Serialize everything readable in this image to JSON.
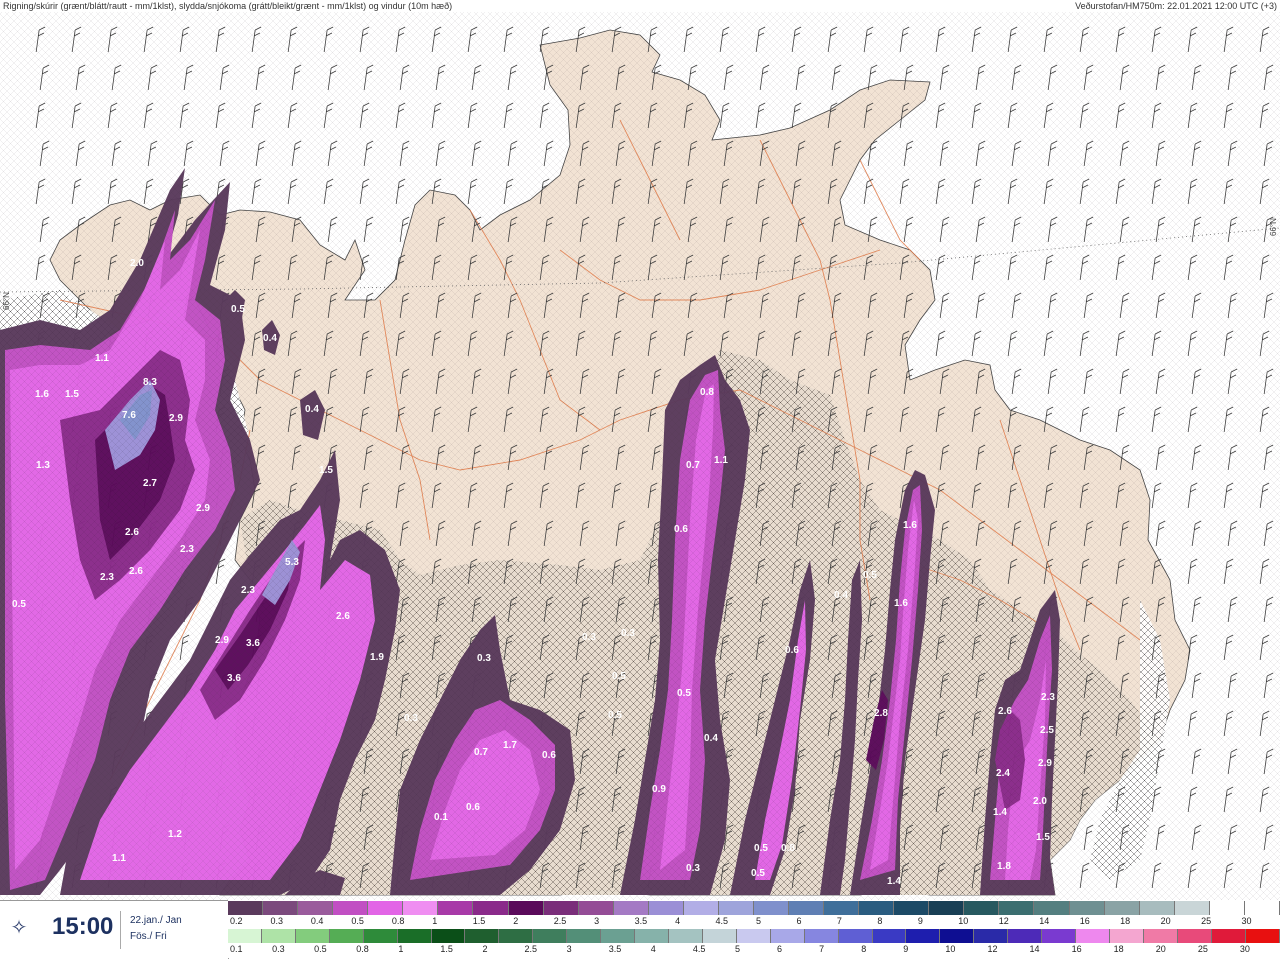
{
  "header": {
    "left": "Rigning/skúrir (grænt/blátt/rautt - mm/1klst), slydda/snjókoma (grátt/bleikt/grænt - mm/1klst) og vindur (10m hæð)",
    "right": "Veðurstofan/HM750m: 22.01.2021 12:00 UTC (+3)"
  },
  "graticule": {
    "left_label": "66°N",
    "right_label": "66°N"
  },
  "time_panel": {
    "icon": "wind-rain-icon",
    "time": "15:00",
    "date": "22.jan./ Jan",
    "day": "Fös./ Fri"
  },
  "legend": {
    "snow_row": {
      "colors": [
        "#5a3a5c",
        "#7b4a7d",
        "#9a5b9c",
        "#c14fc3",
        "#e265e6",
        "#ef8ef1",
        "#a83aa8",
        "#8a2a8a",
        "#5a0a5a",
        "#7a2e7a",
        "#944c96",
        "#a47ac4",
        "#9b8fd6",
        "#b2aee6",
        "#9ea4db",
        "#7f90cc",
        "#5f7fb4",
        "#3f6f9a",
        "#2a5c80",
        "#1c4a66",
        "#193f55",
        "#275960",
        "#3b6e70",
        "#547f80",
        "#6f9092",
        "#8aa3a5",
        "#a8bcbe",
        "#c9d5d7",
        "#ffffff",
        "#ffffff"
      ],
      "labels": [
        "0.2",
        "0.3",
        "0.4",
        "0.5",
        "0.8",
        "1",
        "1.5",
        "2",
        "2.5",
        "3",
        "3.5",
        "4",
        "4.5",
        "5",
        "6",
        "7",
        "8",
        "9",
        "10",
        "12",
        "14",
        "16",
        "18",
        "20",
        "25",
        "30"
      ]
    },
    "rain_row": {
      "colors": [
        "#d7f5d4",
        "#aee3a7",
        "#83cc7d",
        "#55ad55",
        "#2e8b3a",
        "#1a6e28",
        "#0b4f18",
        "#1f5f2f",
        "#2e6e44",
        "#3f7e5d",
        "#538f78",
        "#6ba092",
        "#86b2aa",
        "#a4c3c1",
        "#c4d4d9",
        "#c9c9ef",
        "#a8a8e8",
        "#8686e0",
        "#5f5fd4",
        "#3a3ac4",
        "#1e1eae",
        "#0e0e92",
        "#2a2aa8",
        "#4d2ab8",
        "#7a3ad0",
        "#ee88ee",
        "#f4a6d0",
        "#f07aa6",
        "#e84a7a",
        "#e01a3a",
        "#e81010"
      ],
      "labels": [
        "0.1",
        "0.3",
        "0.5",
        "0.8",
        "1",
        "1.5",
        "2",
        "2.5",
        "3",
        "3.5",
        "4",
        "4.5",
        "5",
        "6",
        "7",
        "8",
        "9",
        "10",
        "12",
        "14",
        "16",
        "18",
        "20",
        "25",
        "30"
      ]
    }
  },
  "map_values": [
    {
      "v": "2.0"
    },
    {
      "v": "0.5"
    },
    {
      "v": "0.4"
    },
    {
      "v": "1.1"
    },
    {
      "v": "8.3"
    },
    {
      "v": "1.6"
    },
    {
      "v": "1.5"
    },
    {
      "v": "7.6"
    },
    {
      "v": "2.9"
    },
    {
      "v": "0.4"
    },
    {
      "v": "1.3"
    },
    {
      "v": "2.7"
    },
    {
      "v": "1.5"
    },
    {
      "v": "2.9"
    },
    {
      "v": "2.6"
    },
    {
      "v": "2.3"
    },
    {
      "v": "5.3"
    },
    {
      "v": "2.3"
    },
    {
      "v": "2.6"
    },
    {
      "v": "2.3"
    },
    {
      "v": "0.5"
    },
    {
      "v": "2.6"
    },
    {
      "v": "2.9"
    },
    {
      "v": "3.6"
    },
    {
      "v": "1.9"
    },
    {
      "v": "3.6"
    },
    {
      "v": "0.3"
    },
    {
      "v": "0.8"
    },
    {
      "v": "0.7"
    },
    {
      "v": "1.1"
    },
    {
      "v": "0.6"
    },
    {
      "v": "1.6"
    },
    {
      "v": "0.4"
    },
    {
      "v": "0.5"
    },
    {
      "v": "1.6"
    },
    {
      "v": "0.3"
    },
    {
      "v": "0.3"
    },
    {
      "v": "0.6"
    },
    {
      "v": "0.5"
    },
    {
      "v": "0.5"
    },
    {
      "v": "0.5"
    },
    {
      "v": "0.3"
    },
    {
      "v": "0.7"
    },
    {
      "v": "1.7"
    },
    {
      "v": "0.6"
    },
    {
      "v": "0.4"
    },
    {
      "v": "2.8"
    },
    {
      "v": "2.6"
    },
    {
      "v": "2.3"
    },
    {
      "v": "2.5"
    },
    {
      "v": "2.4"
    },
    {
      "v": "2.9"
    },
    {
      "v": "1.4"
    },
    {
      "v": "2.0"
    },
    {
      "v": "0.9"
    },
    {
      "v": "1.5"
    },
    {
      "v": "0.1"
    },
    {
      "v": "0.6"
    },
    {
      "v": "0.5"
    },
    {
      "v": "0.8"
    },
    {
      "v": "0.3"
    },
    {
      "v": "0.5"
    },
    {
      "v": "1.2"
    },
    {
      "v": "1.1"
    },
    {
      "v": "1.4"
    },
    {
      "v": "1.8"
    }
  ]
}
